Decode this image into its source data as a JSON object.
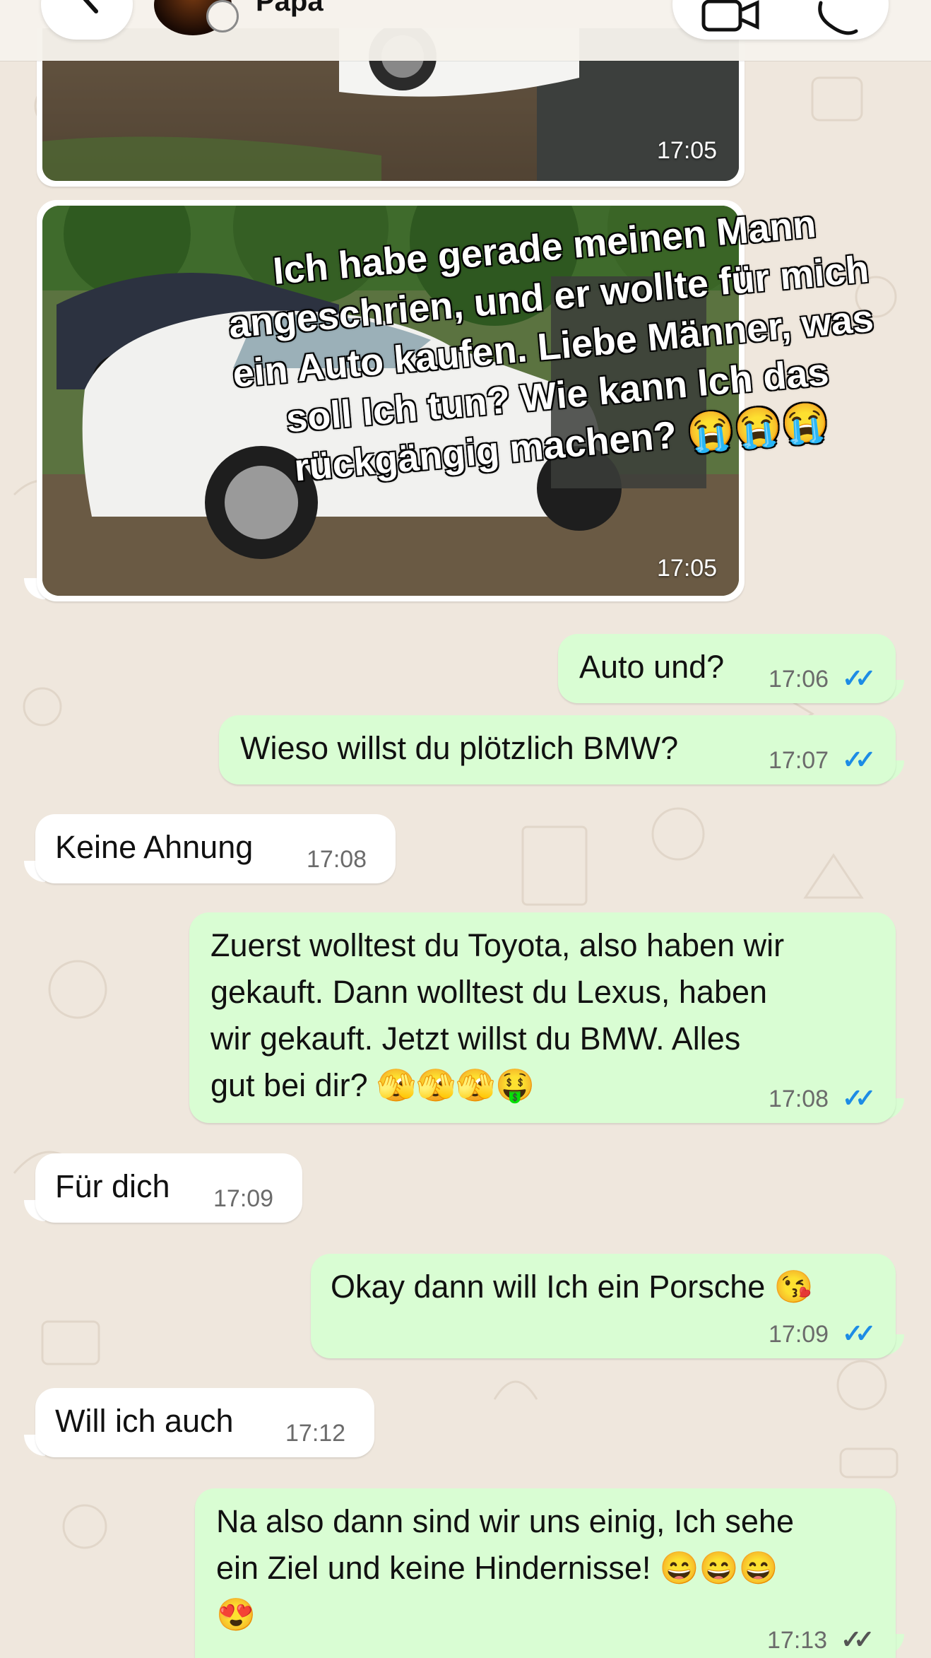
{
  "header": {
    "contact_name": "Papa"
  },
  "messages": [
    {
      "id": "m1",
      "direction": "incoming",
      "type": "image",
      "time": "17:05"
    },
    {
      "id": "m2",
      "direction": "incoming",
      "type": "image",
      "time": "17:05",
      "caption": "Ich habe gerade meinen Mann angeschrien, und er wollte für mich ein Auto kaufen. Liebe Männer, was soll Ich tun? Wie kann Ich das rückgängig machen? 😭😭😭"
    },
    {
      "id": "m3",
      "direction": "outgoing",
      "text": "Auto und?",
      "time": "17:06",
      "status": "read"
    },
    {
      "id": "m4",
      "direction": "outgoing",
      "text": "Wieso willst du plötzlich BMW?",
      "time": "17:07",
      "status": "read"
    },
    {
      "id": "m5",
      "direction": "incoming",
      "text": "Keine Ahnung",
      "time": "17:08"
    },
    {
      "id": "m6",
      "direction": "outgoing",
      "text": "Zuerst wolltest du Toyota, also haben wir\ngekauft. Dann wolltest du Lexus, haben\nwir gekauft. Jetzt willst du BMW. Alles\ngut bei dir? 🫣🫣🫣🤑",
      "time": "17:08",
      "status": "read"
    },
    {
      "id": "m7",
      "direction": "incoming",
      "text": "Für dich",
      "time": "17:09"
    },
    {
      "id": "m8",
      "direction": "outgoing",
      "text": "Okay dann will Ich ein Porsche 😘",
      "time": "17:09",
      "status": "read"
    },
    {
      "id": "m9",
      "direction": "incoming",
      "text": "Will ich auch",
      "time": "17:12"
    },
    {
      "id": "m10",
      "direction": "outgoing",
      "text": "Na also dann sind wir uns einig, Ich sehe\nein Ziel und keine Hindernisse! 😄😄😄\n😍",
      "time": "17:13",
      "status": "delivered"
    }
  ],
  "ticks_glyph": "✓✓",
  "colors": {
    "incoming_bubble": "#ffffff",
    "outgoing_bubble": "#d9fdd3",
    "read_ticks": "#1d8ce5",
    "delivered_ticks": "#555555",
    "wallpaper": "#efe7dd"
  },
  "icons": [
    "back-chevron-icon",
    "status-icon",
    "video-call-icon",
    "phone-icon"
  ]
}
